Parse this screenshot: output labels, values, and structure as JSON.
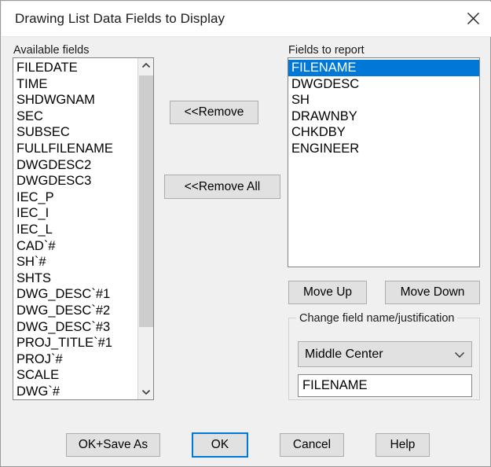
{
  "window": {
    "title": "Drawing List Data Fields to Display",
    "close_icon": "close-icon"
  },
  "available": {
    "label": "Available fields",
    "items": [
      "FILEDATE",
      "TIME",
      "SHDWGNAM",
      "SEC",
      "SUBSEC",
      "FULLFILENAME",
      "DWGDESC2",
      "DWGDESC3",
      "IEC_P",
      "IEC_I",
      "IEC_L",
      "CAD`#",
      "SH`#",
      "SHTS",
      "DWG_DESC`#1",
      "DWG_DESC`#2",
      "DWG_DESC`#3",
      "PROJ_TITLE`#1",
      "PROJ`#",
      "SCALE",
      "DWG`#"
    ],
    "scrollbar": {
      "up_icon": "chevron-up-icon",
      "down_icon": "chevron-down-icon"
    }
  },
  "middle_buttons": {
    "remove": "<<Remove",
    "remove_all": "<<Remove All"
  },
  "report": {
    "label": "Fields to report",
    "items": [
      "FILENAME",
      "DWGDESC",
      "SH",
      "DRAWNBY",
      "CHKDBY",
      "ENGINEER"
    ],
    "selected_index": 0
  },
  "move_buttons": {
    "up": "Move Up",
    "down": "Move Down"
  },
  "change_group": {
    "label": "Change field name/justification",
    "justification_value": "Middle Center",
    "justification_arrow_icon": "chevron-down-icon",
    "field_name_value": "FILENAME",
    "field_name_placeholder": ""
  },
  "footer_buttons": {
    "ok_save_as": "OK+Save As",
    "ok": "OK",
    "cancel": "Cancel",
    "help": "Help"
  },
  "colors": {
    "selection": "#0078d7",
    "dialog_bg": "#f0f0f0",
    "button_bg": "#e1e1e1"
  }
}
